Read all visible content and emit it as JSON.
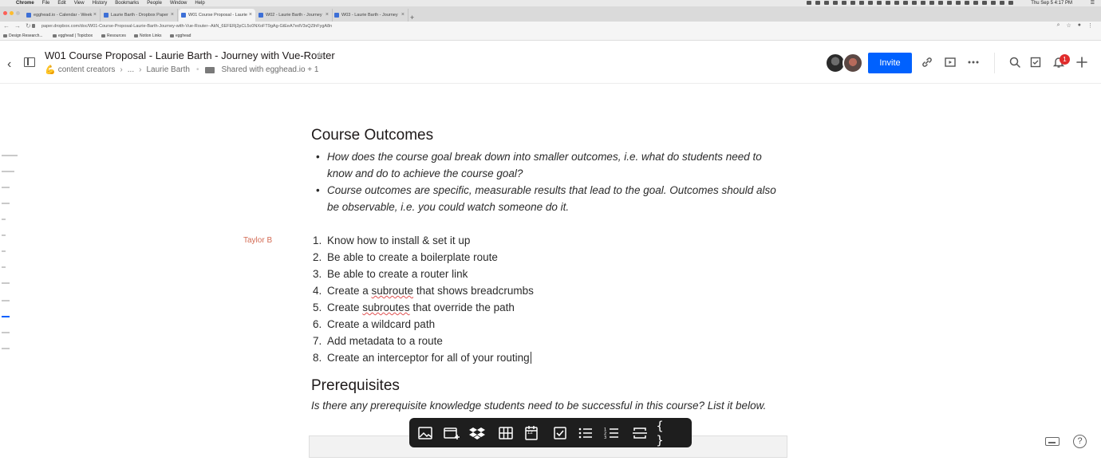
{
  "menubar": {
    "app": "Chrome",
    "menus": [
      "File",
      "Edit",
      "View",
      "History",
      "Bookmarks",
      "People",
      "Window",
      "Help"
    ],
    "clock": "Thu Sep 5  4:17 PM"
  },
  "tabs": [
    {
      "label": "egghead.io - Calendar - Week"
    },
    {
      "label": "Laurie Barth - Dropbox Paper"
    },
    {
      "label": "W01 Course Proposal - Laurie"
    },
    {
      "label": "W02 - Laurie Barth - Journey"
    },
    {
      "label": "W03 - Laurie Barth - Journey"
    }
  ],
  "address": {
    "url": "paper.dropbox.com/doc/W01-Course-Proposal-Laurie-Barth-Journey-with-Vue-Router--AkN_6EFERj2pCL5c0NXoFT9gAg-GtEeA7edV3sQZihFygA8n"
  },
  "bookmarks": [
    {
      "label": "Design Research..."
    },
    {
      "label": "egghead | Topicbox"
    },
    {
      "label": "Resources"
    },
    {
      "label": "Notion Links"
    },
    {
      "label": "egghead"
    }
  ],
  "header": {
    "title": "W01 Course Proposal - Laurie Barth - Journey with Vue-Router",
    "crumb_folder": "content creators",
    "crumb_sep": "›",
    "crumb_ellipsis": "...",
    "crumb_sep2": "›",
    "crumb_owner": "Laurie Barth",
    "crumb_dot": "•",
    "shared": "Shared with egghead.io + 1",
    "invite_label": "Invite",
    "notification_count": "1"
  },
  "doc": {
    "outcomes_heading": "Course Outcomes",
    "outcome_bullets": [
      "How does the course goal break down into smaller outcomes, i.e. what do students need to know and do to achieve the course goal?",
      "Course outcomes are specific, measurable results that lead to the goal. Outcomes should also be observable, i.e. you could watch someone do it."
    ],
    "comment_author": "Taylor B",
    "outcomes": [
      {
        "num": "1.",
        "text": "Know how to install & set it up"
      },
      {
        "num": "2.",
        "text": "Be able to create a boilerplate route"
      },
      {
        "num": "3.",
        "text": "Be able to create a router link"
      },
      {
        "num": "4.",
        "pre": "Create a ",
        "misspelled": "subroute",
        "post": " that shows breadcrumbs"
      },
      {
        "num": "5.",
        "pre": "Create ",
        "misspelled": "subroutes",
        "post": " that override the path"
      },
      {
        "num": "6.",
        "text": "Create a wildcard path"
      },
      {
        "num": "7.",
        "text": "Add metadata to a route"
      },
      {
        "num": "8.",
        "text": "Create an interceptor for all of your routing"
      }
    ],
    "prereq_heading": "Prerequisites",
    "prereq_text": "Is there any prerequisite knowledge students need to be successful in this course? List it below."
  },
  "toolbar": {
    "items": [
      "image-icon",
      "media-icon",
      "dropbox-icon",
      "table-icon",
      "calendar-icon",
      "checkbox-icon",
      "bulleted-list-icon",
      "numbered-list-icon",
      "divider-icon",
      "code-icon"
    ],
    "calendar_day": "12"
  },
  "colors": {
    "accent": "#0061fe",
    "badge": "#e02c2c",
    "comment_author": "#d36b54",
    "toolbar_bg": "#1e1e1e"
  }
}
